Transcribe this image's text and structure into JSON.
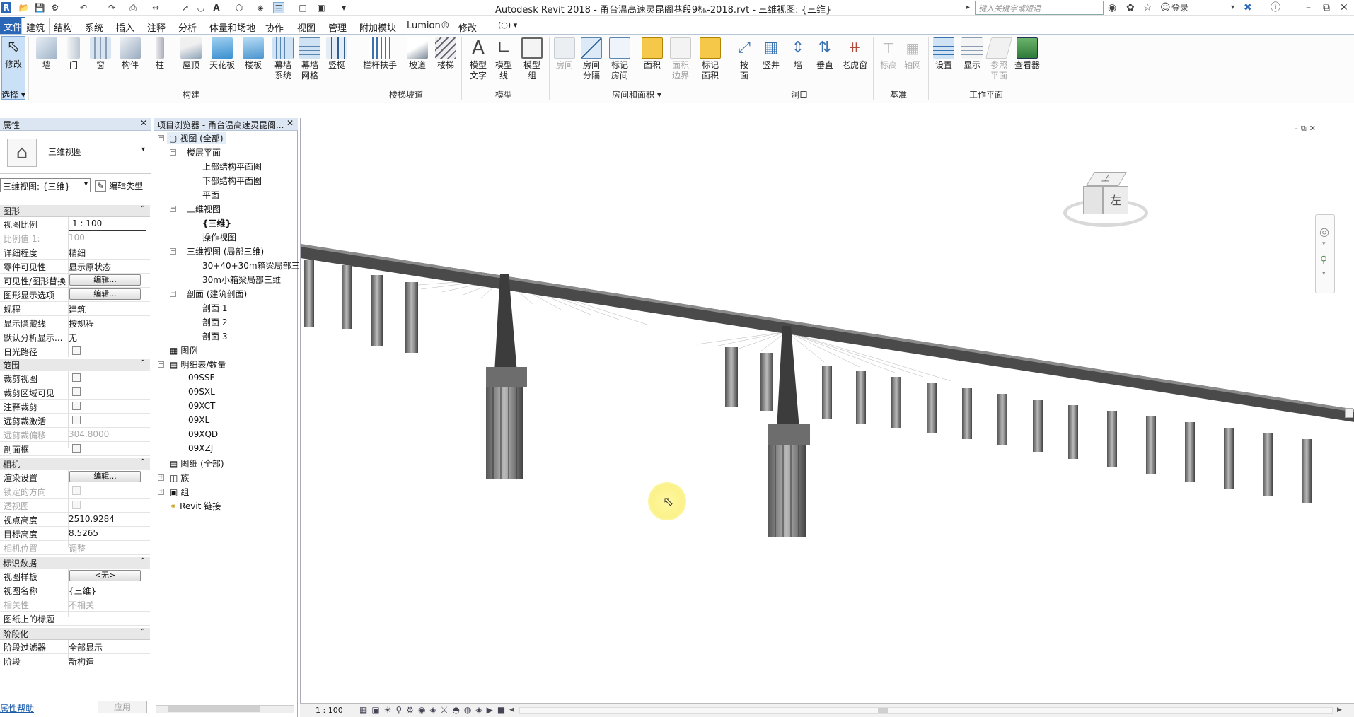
{
  "app": {
    "title": "Autodesk Revit 2018 -    甬台温高速灵昆阁巷段9标-2018.rvt - 三维视图: {三维}",
    "search_placeholder": "键入关键字或短语",
    "login": "登录"
  },
  "menu": {
    "tabs": [
      "文件",
      "建筑",
      "结构",
      "系统",
      "插入",
      "注释",
      "分析",
      "体量和场地",
      "协作",
      "视图",
      "管理",
      "附加模块",
      "Lumion®",
      "修改"
    ],
    "active": "建筑"
  },
  "ribbon": {
    "buttons": [
      {
        "name": "modify",
        "label": "修改",
        "sub": "选择 ▾"
      },
      {
        "name": "wall",
        "label": "墙"
      },
      {
        "name": "door",
        "label": "门"
      },
      {
        "name": "window",
        "label": "窗"
      },
      {
        "name": "component",
        "label": "构件"
      },
      {
        "name": "column",
        "label": "柱"
      },
      {
        "name": "roof",
        "label": "屋顶"
      },
      {
        "name": "ceiling",
        "label": "天花板"
      },
      {
        "name": "floor",
        "label": "楼板"
      },
      {
        "name": "curtain-system",
        "label": "幕墙\n系统"
      },
      {
        "name": "curtain-grid",
        "label": "幕墙\n网格"
      },
      {
        "name": "mullion",
        "label": "竖梃"
      },
      {
        "name": "railing",
        "label": "栏杆扶手"
      },
      {
        "name": "ramp",
        "label": "坡道"
      },
      {
        "name": "stair",
        "label": "楼梯"
      },
      {
        "name": "model-text",
        "label": "模型\n文字"
      },
      {
        "name": "model-line",
        "label": "模型\n线"
      },
      {
        "name": "model-group",
        "label": "模型\n组"
      },
      {
        "name": "room",
        "label": "房间"
      },
      {
        "name": "room-separator",
        "label": "房间\n分隔"
      },
      {
        "name": "tag-room",
        "label": "标记\n房间"
      },
      {
        "name": "area",
        "label": "面积"
      },
      {
        "name": "area-boundary",
        "label": "面积\n边界"
      },
      {
        "name": "tag-area",
        "label": "标记\n面积"
      },
      {
        "name": "by-face",
        "label": "按\n面"
      },
      {
        "name": "shaft",
        "label": "竖井"
      },
      {
        "name": "wall-opening",
        "label": "墙"
      },
      {
        "name": "vertical",
        "label": "垂直"
      },
      {
        "name": "dormer",
        "label": "老虎窗"
      },
      {
        "name": "level",
        "label": "标高"
      },
      {
        "name": "grid",
        "label": "轴网"
      },
      {
        "name": "set",
        "label": "设置"
      },
      {
        "name": "show",
        "label": "显示"
      },
      {
        "name": "ref-plane",
        "label": "参照\n平面"
      },
      {
        "name": "viewer",
        "label": "查看器"
      }
    ],
    "groups": [
      "构建",
      "楼梯坡道",
      "模型",
      "房间和面积 ▾",
      "洞口",
      "基准",
      "工作平面"
    ]
  },
  "properties": {
    "title": "属性",
    "type_name": "三维视图",
    "view_selector": "三维视图: {三维}",
    "edit_type": "编辑类型",
    "sections": {
      "graphics": "图形",
      "extents": "范围",
      "camera": "相机",
      "identity": "标识数据",
      "phasing": "阶段化"
    },
    "rows": {
      "scale_k": "视图比例",
      "scale_v": "1 : 100",
      "scale_val_k": "比例值 1:",
      "scale_val_v": "100",
      "detail_k": "详细程度",
      "detail_v": "精细",
      "parts_k": "零件可见性",
      "parts_v": "显示原状态",
      "vg_k": "可见性/图形替换",
      "vg_btn": "编辑...",
      "gdo_k": "图形显示选项",
      "gdo_btn": "编辑...",
      "discipline_k": "规程",
      "discipline_v": "建筑",
      "hidden_k": "显示隐藏线",
      "hidden_v": "按规程",
      "analysis_k": "默认分析显示...",
      "analysis_v": "无",
      "sun_k": "日光路径",
      "crop_k": "裁剪视图",
      "crop_vis_k": "裁剪区域可见",
      "anno_crop_k": "注释裁剪",
      "far_clip_k": "远剪裁激活",
      "far_off_k": "远剪裁偏移",
      "far_off_v": "304.8000",
      "section_box_k": "剖面框",
      "render_k": "渲染设置",
      "render_btn": "编辑...",
      "locked_k": "锁定的方向",
      "persp_k": "透视图",
      "eye_k": "视点高度",
      "eye_v": "2510.9284",
      "target_k": "目标高度",
      "target_v": "8.5265",
      "cam_pos_k": "相机位置",
      "cam_pos_v": "调整",
      "template_k": "视图样板",
      "template_btn": "<无>",
      "view_name_k": "视图名称",
      "view_name_v": "{三维}",
      "depend_k": "相关性",
      "depend_v": "不相关",
      "sheet_title_k": "图纸上的标题",
      "phase_filter_k": "阶段过滤器",
      "phase_filter_v": "全部显示",
      "phase_k": "阶段",
      "phase_v": "新构造"
    },
    "help": "属性帮助",
    "apply": "应用"
  },
  "browser": {
    "title": "项目浏览器 - 甬台温高速灵昆阁...",
    "nodes": {
      "views": "视图 (全部)",
      "floor_plans": "楼层平面",
      "fp1": "上部结构平面图",
      "fp2": "下部结构平面图",
      "fp3": "平面",
      "views3d": "三维视图",
      "v3d1": "{三维}",
      "v3d2": "操作视图",
      "local3d": "三维视图 (局部三维)",
      "l1": "30+40+30m箱梁局部三",
      "l2": "30m小箱梁局部三维",
      "sections": "剖面 (建筑剖面)",
      "s1": "剖面 1",
      "s2": "剖面 2",
      "s3": "剖面 3",
      "legends": "图例",
      "schedules": "明细表/数量",
      "sc1": "09SSF",
      "sc2": "09SXL",
      "sc3": "09XCT",
      "sc4": "09XL",
      "sc5": "09XQD",
      "sc6": "09XZJ",
      "sheets": "图纸 (全部)",
      "families": "族",
      "groups": "组",
      "links": "Revit 链接"
    }
  },
  "viewcube": {
    "top": "上",
    "left": "左"
  },
  "status": {
    "scale": "1 : 100"
  },
  "colors": {
    "file_tab": "#2b67b7",
    "panel_header": "#dce6f2",
    "cursor_highlight": "#fbf28a"
  }
}
